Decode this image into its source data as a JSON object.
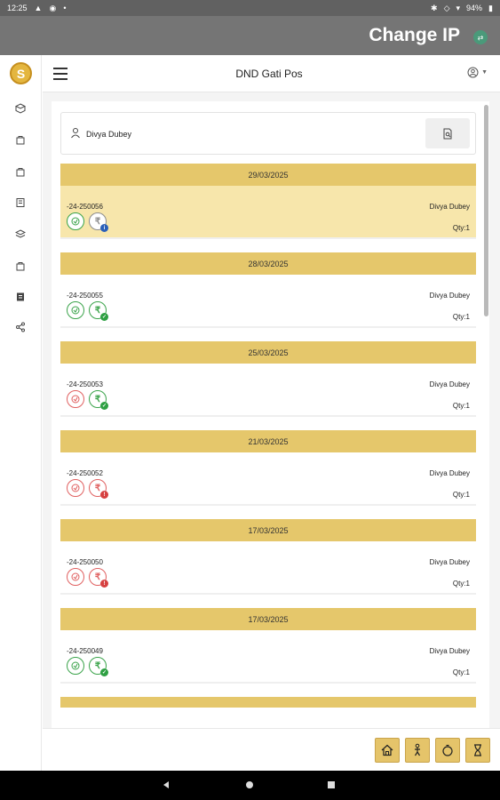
{
  "status_bar": {
    "time": "12:25",
    "battery": "94%"
  },
  "app_bar": {
    "title": "Change IP",
    "ip_icon": "ip-switch-icon"
  },
  "header": {
    "title": "DND Gati Pos"
  },
  "customer": {
    "name": "Divya Dubey"
  },
  "orders": [
    {
      "date": "29/03/2025",
      "order_no": "-24-250056",
      "customer": "Divya Dubey",
      "qty": "Qty:1",
      "selected": true,
      "status1": "green",
      "status2": "gray",
      "badge": "blue"
    },
    {
      "date": "28/03/2025",
      "order_no": "-24-250055",
      "customer": "Divya Dubey",
      "qty": "Qty:1",
      "selected": false,
      "status1": "green",
      "status2": "green",
      "badge": "green"
    },
    {
      "date": "25/03/2025",
      "order_no": "-24-250053",
      "customer": "Divya Dubey",
      "qty": "Qty:1",
      "selected": false,
      "status1": "red",
      "status2": "green",
      "badge": "green"
    },
    {
      "date": "21/03/2025",
      "order_no": "-24-250052",
      "customer": "Divya Dubey",
      "qty": "Qty:1",
      "selected": false,
      "status1": "red",
      "status2": "red",
      "badge": "red"
    },
    {
      "date": "17/03/2025",
      "order_no": "-24-250050",
      "customer": "Divya Dubey",
      "qty": "Qty:1",
      "selected": false,
      "status1": "red",
      "status2": "red",
      "badge": "red"
    },
    {
      "date": "17/03/2025",
      "order_no": "-24-250049",
      "customer": "Divya Dubey",
      "qty": "Qty:1",
      "selected": false,
      "status1": "green",
      "status2": "green",
      "badge": "green"
    }
  ],
  "colors": {
    "accent": "#e5c76b",
    "selected_row": "#f7e6ab",
    "app_bar": "#757575"
  }
}
